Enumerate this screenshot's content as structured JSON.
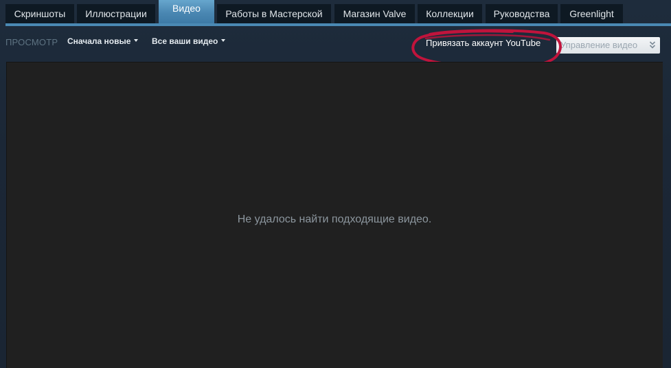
{
  "tabs": [
    {
      "label": "Скриншоты",
      "active": false
    },
    {
      "label": "Иллюстрации",
      "active": false
    },
    {
      "label": "Видео",
      "active": true
    },
    {
      "label": "Работы в Мастерской",
      "active": false
    },
    {
      "label": "Магазин Valve",
      "active": false
    },
    {
      "label": "Коллекции",
      "active": false
    },
    {
      "label": "Руководства",
      "active": false
    },
    {
      "label": "Greenlight",
      "active": false
    }
  ],
  "toolbar": {
    "view_label": "ПРОСМОТР",
    "sort_dropdown": "Сначала новые",
    "filter_dropdown": "Все ваши видео",
    "link_youtube": "Привязать аккаунт YouTube",
    "manage_button": "Управление видео"
  },
  "content": {
    "empty_message": "Не удалось найти подходящие видео."
  },
  "colors": {
    "background": "#1b2838",
    "tab_inactive": "#0e1923",
    "tab_active": "#4a87b2",
    "panel": "#202020",
    "annotation": "#c0143c"
  },
  "icons": {
    "dropdown_caret": "caret-down-icon",
    "manage_chevrons": "double-chevron-down-icon"
  }
}
